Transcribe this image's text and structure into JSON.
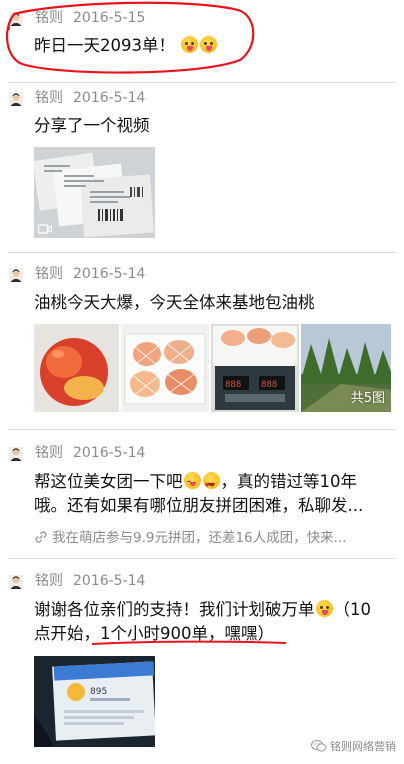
{
  "posts": [
    {
      "author": "铭则",
      "date": "2016-5-15",
      "text": "昨日一天2093单！"
    },
    {
      "author": "铭则",
      "date": "2016-5-14",
      "text": "分享了一个视频"
    },
    {
      "author": "铭则",
      "date": "2016-5-14",
      "text": "油桃今天大爆，今天全体来基地包油桃",
      "image_count": "共5图"
    },
    {
      "author": "铭则",
      "date": "2016-5-14",
      "text_a": "帮这位美女团一下吧",
      "text_b": "，真的错过等10年哦。还有如果有哪位朋友拼团困难，私聊发...",
      "share": "我在萌店参与9.9元拼团，还差16人成团，快来..."
    },
    {
      "author": "铭则",
      "date": "2016-5-14",
      "text_a": "谢谢各位亲们的支持！我们计划破万单",
      "text_b": "（10点开始，1个小时900单，嘿嘿）",
      "screen_number": "895"
    }
  ],
  "watermark": "铭则网络营销",
  "colors": {
    "annotation_red": "#e8141c",
    "meta_gray": "#8a8a8a",
    "divider": "#dcdcdc"
  },
  "icons": [
    "avatar-icon",
    "video-icon",
    "link-icon",
    "wechat-icon"
  ]
}
